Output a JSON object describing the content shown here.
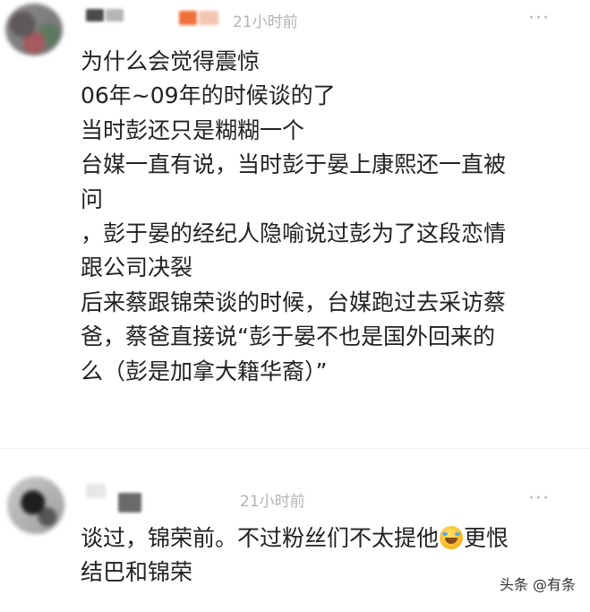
{
  "comments": [
    {
      "time": "21小时前",
      "more": "···",
      "lines": [
        "为什么会觉得震惊",
        "06年~09年的时候谈的了",
        "当时彭还只是糊糊一个",
        "台媒一直有说，当时彭于晏上康熙还一直被",
        "问",
        "，彭于晏的经纪人隐喻说过彭为了这段恋情",
        "跟公司决裂",
        "后来蔡跟锦荣谈的时候，台媒跑过去采访蔡",
        "爸，蔡爸直接说“彭于晏不也是国外回来的",
        "么（彭是加拿大籍华裔）”"
      ]
    },
    {
      "time": "21小时前",
      "more": "···",
      "line1_before_emoji": "谈过，锦荣前。不过粉丝们不太提他",
      "emoji": "rolling-on-floor-laughing-emoji",
      "line1_after_emoji": "更恨",
      "line2": "结巴和锦荣"
    }
  ],
  "watermark": "头条 @有条"
}
